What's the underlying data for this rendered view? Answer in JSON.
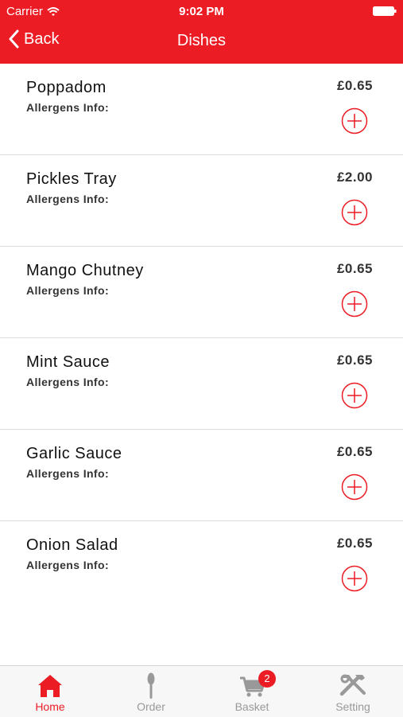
{
  "status_bar": {
    "carrier": "Carrier",
    "time": "9:02 PM"
  },
  "nav": {
    "back_label": "Back",
    "title": "Dishes"
  },
  "dishes": [
    {
      "name": "Poppadom",
      "allergens_label": "Allergens Info:",
      "price": "£0.65"
    },
    {
      "name": "Pickles Tray",
      "allergens_label": "Allergens Info:",
      "price": "£2.00"
    },
    {
      "name": "Mango Chutney",
      "allergens_label": "Allergens Info:",
      "price": "£0.65"
    },
    {
      "name": "Mint Sauce",
      "allergens_label": "Allergens Info:",
      "price": "£0.65"
    },
    {
      "name": "Garlic Sauce",
      "allergens_label": "Allergens Info:",
      "price": "£0.65"
    },
    {
      "name": "Onion Salad",
      "allergens_label": "Allergens Info:",
      "price": "£0.65"
    }
  ],
  "tabs": [
    {
      "label": "Home",
      "icon": "home-icon"
    },
    {
      "label": "Order",
      "icon": "spoon-icon"
    },
    {
      "label": "Basket",
      "icon": "cart-icon",
      "badge": "2"
    },
    {
      "label": "Setting",
      "icon": "tools-icon"
    }
  ],
  "colors": {
    "accent": "#ec1c24",
    "inactive": "#999999"
  }
}
